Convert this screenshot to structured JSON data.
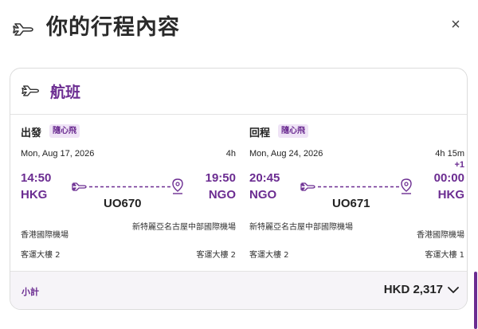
{
  "header": {
    "title": "你的行程內容",
    "close_label": "×",
    "plane_icon": "plane-icon"
  },
  "card": {
    "title": "航班",
    "outbound": {
      "label": "出發",
      "badge": "隨心飛",
      "date": "Mon, Aug 17, 2026",
      "duration": "4h",
      "dep_time": "14:50",
      "dep_code": "HKG",
      "arr_time": "19:50",
      "arr_code": "NGO",
      "flight_no": "UO670",
      "dep_airport": "香港國際機場",
      "arr_airport": "新特麗亞名古屋中部國際機場",
      "dep_terminal": "客運大樓 2",
      "arr_terminal": "客運大樓 2"
    },
    "return": {
      "label": "回程",
      "badge": "隨心飛",
      "date": "Mon, Aug 24, 2026",
      "duration": "4h 15m",
      "plus_day": "+1",
      "dep_time": "20:45",
      "dep_code": "NGO",
      "arr_time": "00:00",
      "arr_code": "HKG",
      "flight_no": "UO671",
      "dep_airport": "新特麗亞名古屋中部國際機場",
      "arr_airport": "香港國際機場",
      "dep_terminal": "客運大樓 2",
      "arr_terminal": "客運大樓 1"
    },
    "subtotal_label": "小計",
    "subtotal_value": "HKD 2,317"
  },
  "colors": {
    "accent": "#6b2c91",
    "badge_bg": "#efe3f6",
    "subtotal_bg": "#f6f4f8"
  }
}
